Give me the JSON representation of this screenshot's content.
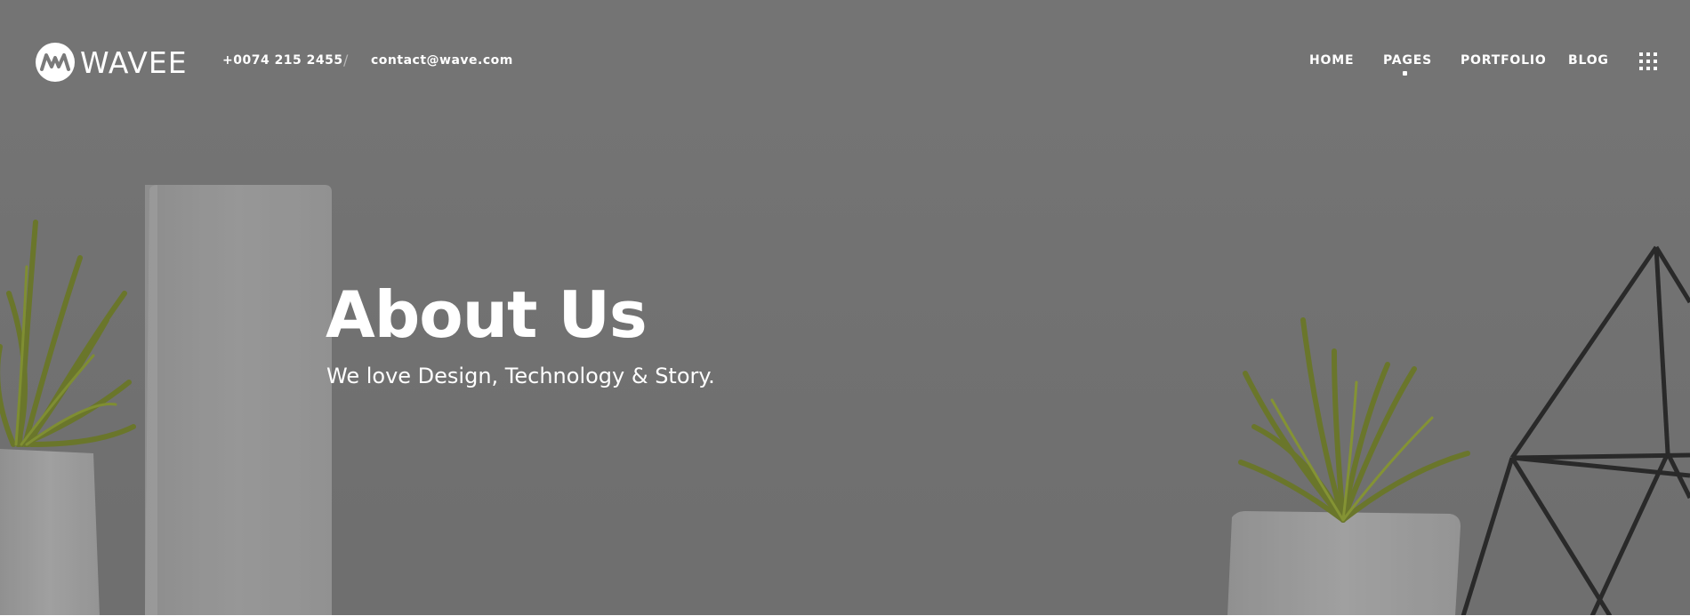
{
  "brand": {
    "name": "WAVEE",
    "logo_icon": "wave-logo-icon"
  },
  "contact": {
    "phone": "+0074 215 2455",
    "separator": "/",
    "email": "contact@wave.com"
  },
  "nav": {
    "items": [
      {
        "label": "HOME",
        "active": false
      },
      {
        "label": "PAGES",
        "active": true
      },
      {
        "label": "PORTFOLIO",
        "active": false
      },
      {
        "label": "BLOG",
        "active": false
      }
    ],
    "menu_icon": "grid-menu-icon"
  },
  "hero": {
    "title": "About Us",
    "subtitle": "We love Design, Technology & Story."
  },
  "colors": {
    "background": "#797979",
    "text": "#ffffff",
    "plant": "#7a8a1f",
    "frame": "#1e1e1e"
  }
}
